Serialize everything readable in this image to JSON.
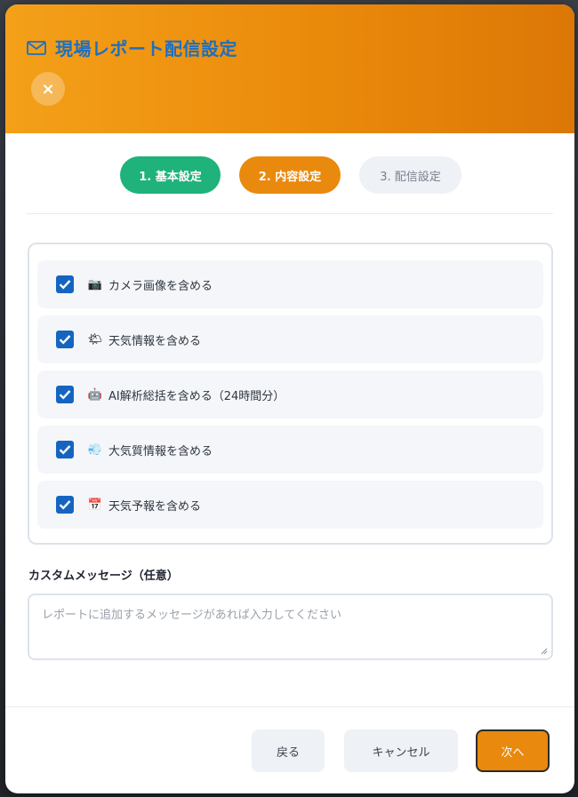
{
  "header": {
    "title": "現場レポート配信設定",
    "title_icon": "envelope-icon",
    "close_label": "×",
    "colors": {
      "gradient_start": "#f4a019",
      "gradient_end": "#dc7706",
      "title": "#1e6fc0"
    }
  },
  "steps": [
    {
      "label": "1. 基本設定",
      "state": "completed",
      "color": "#1fb27a"
    },
    {
      "label": "2. 内容設定",
      "state": "active",
      "color": "#e9890d"
    },
    {
      "label": "3. 配信設定",
      "state": "pending",
      "color": "#eef1f5"
    }
  ],
  "options": [
    {
      "label": "カメラ画像を含める",
      "checked": true,
      "icon": "camera-icon",
      "glyph": "📷"
    },
    {
      "label": "天気情報を含める",
      "checked": true,
      "icon": "weather-icon",
      "glyph": "🌤"
    },
    {
      "label": "AI解析総括を含める（24時間分）",
      "checked": true,
      "icon": "robot-icon",
      "glyph": "🤖"
    },
    {
      "label": "大気質情報を含める",
      "checked": true,
      "icon": "air-quality-icon",
      "glyph": "💨"
    },
    {
      "label": "天気予報を含める",
      "checked": true,
      "icon": "calendar-icon",
      "glyph": "📅"
    }
  ],
  "custom_message": {
    "label": "カスタムメッセージ（任意）",
    "placeholder": "レポートに追加するメッセージがあれば入力してください",
    "value": ""
  },
  "footer": {
    "back_label": "戻る",
    "cancel_label": "キャンセル",
    "next_label": "次へ"
  }
}
